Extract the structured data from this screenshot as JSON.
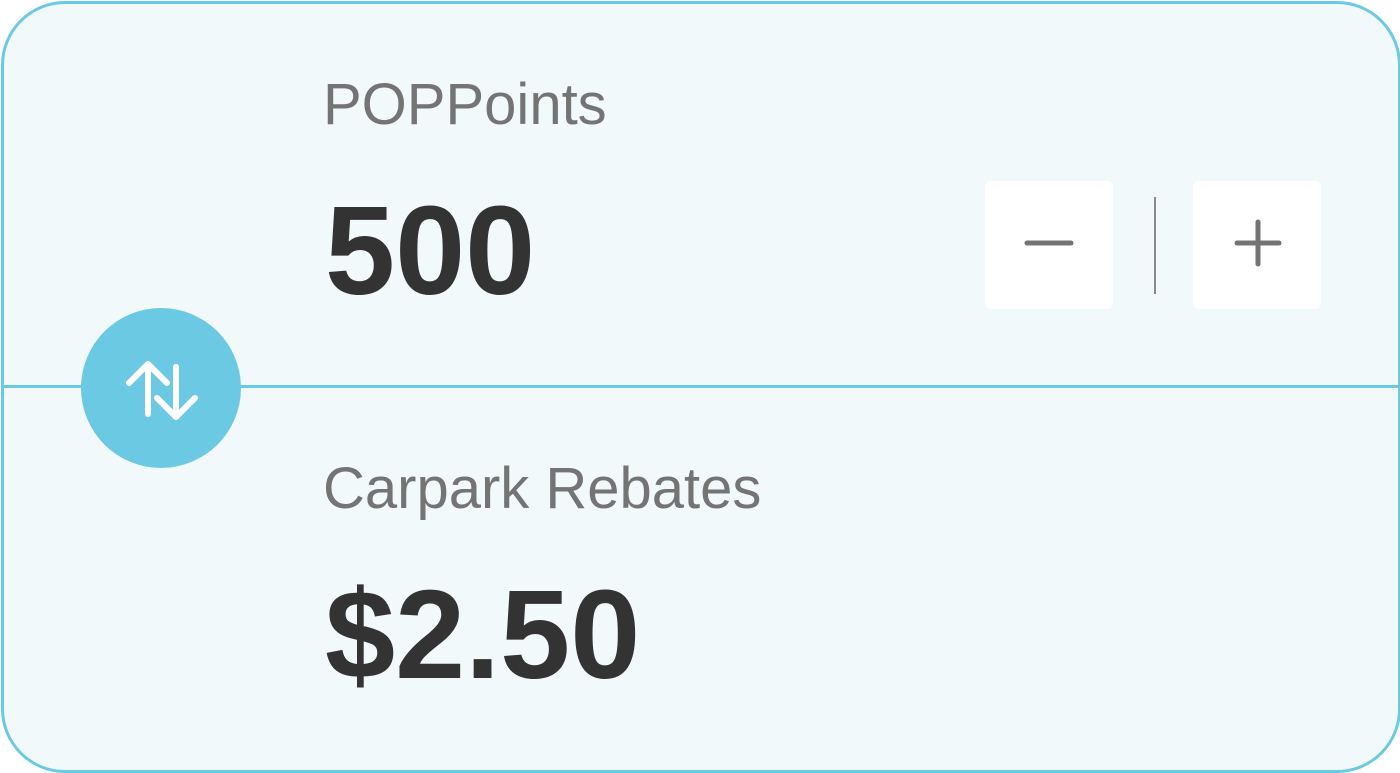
{
  "colors": {
    "accent": "#6cc9e3",
    "card_background": "#f1f9fb",
    "label_text": "#747474",
    "value_text": "#333333",
    "stepper_background": "#ffffff",
    "stepper_icon": "#747474"
  },
  "points": {
    "label": "POPPoints",
    "value": "500"
  },
  "stepper": {
    "decrement_icon": "minus-icon",
    "increment_icon": "plus-icon"
  },
  "swap": {
    "icon": "swap-vertical-arrows-icon"
  },
  "rebate": {
    "label": "Carpark Rebates",
    "value": "$2.50"
  }
}
